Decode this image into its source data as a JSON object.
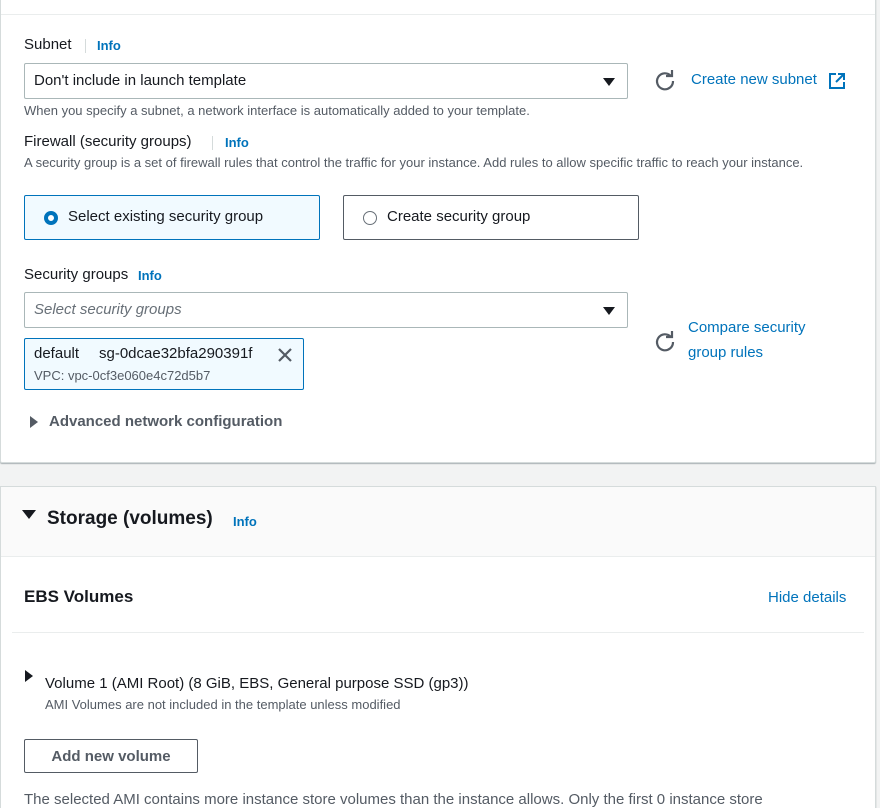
{
  "network": {
    "subnet": {
      "label": "Subnet",
      "info": "Info",
      "selected": "Don't include in launch template",
      "create_link": "Create new subnet",
      "description": "When you specify a subnet, a network interface is automatically added to your template."
    },
    "firewall": {
      "label": "Firewall (security groups)",
      "info": "Info",
      "description": "A security group is a set of firewall rules that control the traffic for your instance. Add rules to allow specific traffic to reach your instance.",
      "options": [
        {
          "label": "Select existing security group",
          "selected": true
        },
        {
          "label": "Create security group",
          "selected": false
        }
      ]
    },
    "security_groups": {
      "label": "Security groups",
      "info": "Info",
      "placeholder": "Select security groups",
      "compare_link_line1": "Compare security",
      "compare_link_line2": "group rules",
      "token": {
        "name": "default",
        "id": "sg-0dcae32bfa290391f",
        "vpc": "VPC: vpc-0cf3e060e4c72d5b7"
      }
    },
    "advanced": "Advanced network configuration"
  },
  "storage": {
    "title": "Storage (volumes)",
    "info": "Info",
    "ebs_title": "EBS Volumes",
    "hide_details": "Hide details",
    "volume": {
      "title": "Volume 1 (AMI Root) (8 GiB, EBS, General purpose SSD (gp3))",
      "note": "AMI Volumes are not included in the template unless modified"
    },
    "add_button": "Add new volume",
    "footer_text": "The selected AMI contains more instance store volumes than the instance allows. Only the first 0 instance store"
  },
  "colors": {
    "accent": "#0073bb",
    "text": "#16191f",
    "muted": "#545b64"
  }
}
